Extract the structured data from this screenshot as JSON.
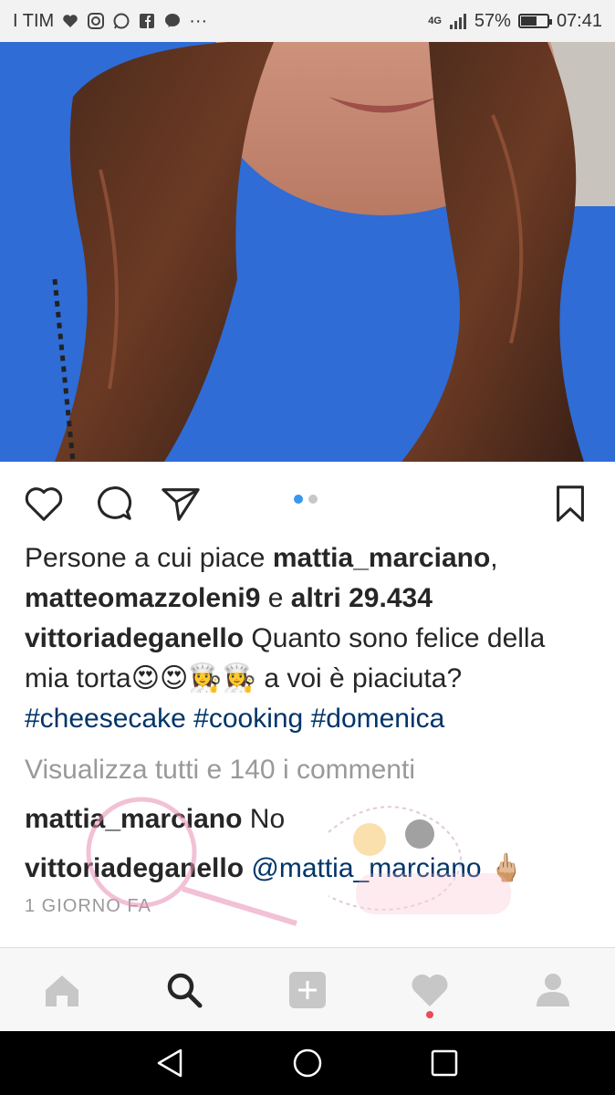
{
  "status_bar": {
    "carrier": "I TIM",
    "network": "4G",
    "battery": "57%",
    "battery_level": 0.57,
    "time": "07:41",
    "more": "···"
  },
  "post": {
    "carousel_count": 2,
    "carousel_active": 1,
    "likes_prefix": "Persone a cui piace ",
    "liker_1": "mattia_marciano",
    "liker_sep": ",",
    "liker_2": "matteomazzoleni9",
    "likes_conj": " e ",
    "likes_others": "altri 29.434",
    "caption_user": "vittoriadeganello",
    "caption_text_1": " Quanto sono felice della",
    "caption_text_2": "mia torta",
    "caption_emojis": "😍😍👩‍🍳👩‍🍳",
    "caption_text_3": " a voi è piaciuta?",
    "hashtags": [
      "#cheesecake",
      "#cooking",
      "#domenica"
    ],
    "view_comments": "Visualizza tutti e 140 i commenti",
    "comments": [
      {
        "user": "mattia_marciano",
        "text": " No"
      },
      {
        "user": "vittoriadeganello",
        "text": " @mattia_marciano ",
        "emoji": "🖕🏼"
      }
    ],
    "timestamp": "1 GIORNO FA"
  },
  "icons": {
    "like": "heart-icon",
    "comment": "comment-icon",
    "share": "send-icon",
    "save": "bookmark-icon"
  },
  "nav": [
    "home-icon",
    "search-icon",
    "add-icon",
    "activity-icon",
    "profile-icon"
  ],
  "colors": {
    "accent": "#3897f0",
    "hashtag": "#003569",
    "grey_text": "#999999",
    "notification": "#ed4956"
  }
}
